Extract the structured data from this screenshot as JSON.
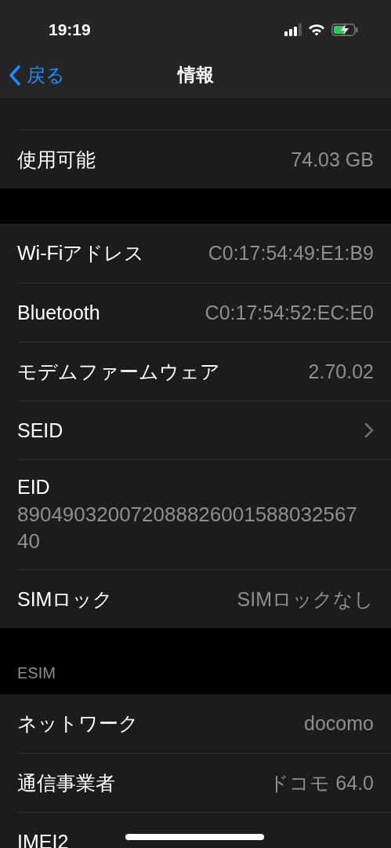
{
  "status_bar": {
    "time": "19:19"
  },
  "nav": {
    "back_label": "戻る",
    "title": "情報"
  },
  "groups": [
    {
      "rows": [
        {
          "kind": "value",
          "label": "使用可能",
          "value": "74.03 GB"
        }
      ]
    },
    {
      "rows": [
        {
          "kind": "value",
          "label": "Wi-Fiアドレス",
          "value": "C0:17:54:49:E1:B9"
        },
        {
          "kind": "value",
          "label": "Bluetooth",
          "value": "C0:17:54:52:EC:E0"
        },
        {
          "kind": "value",
          "label": "モデムファームウェア",
          "value": "2.70.02"
        },
        {
          "kind": "disclosure",
          "label": "SEID"
        },
        {
          "kind": "stacked",
          "label": "EID",
          "value": "89049032007208882600158803256740"
        },
        {
          "kind": "value",
          "label": "SIMロック",
          "value": "SIMロックなし"
        }
      ]
    },
    {
      "header": "ESIM",
      "rows": [
        {
          "kind": "value",
          "label": "ネットワーク",
          "value": "docomo"
        },
        {
          "kind": "value",
          "label": "通信事業者",
          "value": "ドコモ 64.0"
        },
        {
          "kind": "value",
          "label": "IMEI2"
        }
      ]
    }
  ]
}
